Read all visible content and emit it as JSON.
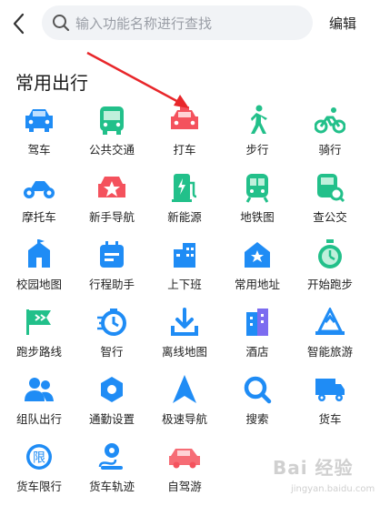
{
  "header": {
    "search_placeholder": "输入功能名称进行查找",
    "edit_label": "编辑"
  },
  "section": {
    "title": "常用出行"
  },
  "items": [
    {
      "label": "驾车",
      "icon": "car-icon"
    },
    {
      "label": "公共交通",
      "icon": "bus-icon"
    },
    {
      "label": "打车",
      "icon": "taxi-icon"
    },
    {
      "label": "步行",
      "icon": "walk-icon"
    },
    {
      "label": "骑行",
      "icon": "bike-icon"
    },
    {
      "label": "摩托车",
      "icon": "motorcycle-icon"
    },
    {
      "label": "新手导航",
      "icon": "novice-car-icon"
    },
    {
      "label": "新能源",
      "icon": "charging-pile-icon"
    },
    {
      "label": "地铁图",
      "icon": "subway-icon"
    },
    {
      "label": "查公交",
      "icon": "bus-search-icon"
    },
    {
      "label": "校园地图",
      "icon": "campus-icon"
    },
    {
      "label": "行程助手",
      "icon": "calendar-icon"
    },
    {
      "label": "上下班",
      "icon": "commute-building-icon"
    },
    {
      "label": "常用地址",
      "icon": "star-home-icon"
    },
    {
      "label": "开始跑步",
      "icon": "stopwatch-icon"
    },
    {
      "label": "跑步路线",
      "icon": "flag-icon"
    },
    {
      "label": "智行",
      "icon": "smart-travel-icon"
    },
    {
      "label": "离线地图",
      "icon": "download-icon"
    },
    {
      "label": "酒店",
      "icon": "hotel-icon"
    },
    {
      "label": "智能旅游",
      "icon": "travel-icon"
    },
    {
      "label": "组队出行",
      "icon": "group-icon"
    },
    {
      "label": "通勤设置",
      "icon": "settings-icon"
    },
    {
      "label": "极速导航",
      "icon": "navigation-arrow-icon"
    },
    {
      "label": "搜索",
      "icon": "search-circle-icon"
    },
    {
      "label": "货车",
      "icon": "truck-icon"
    },
    {
      "label": "货车限行",
      "icon": "restriction-icon"
    },
    {
      "label": "货车轨迹",
      "icon": "track-icon"
    },
    {
      "label": "自驾游",
      "icon": "road-trip-car-icon"
    }
  ],
  "watermark": {
    "text": "Bai 经验",
    "sub": "jingyan.baidu.com"
  },
  "colors": {
    "blue": "#1f8cf5",
    "green": "#22c08a",
    "red": "#f4525d"
  }
}
